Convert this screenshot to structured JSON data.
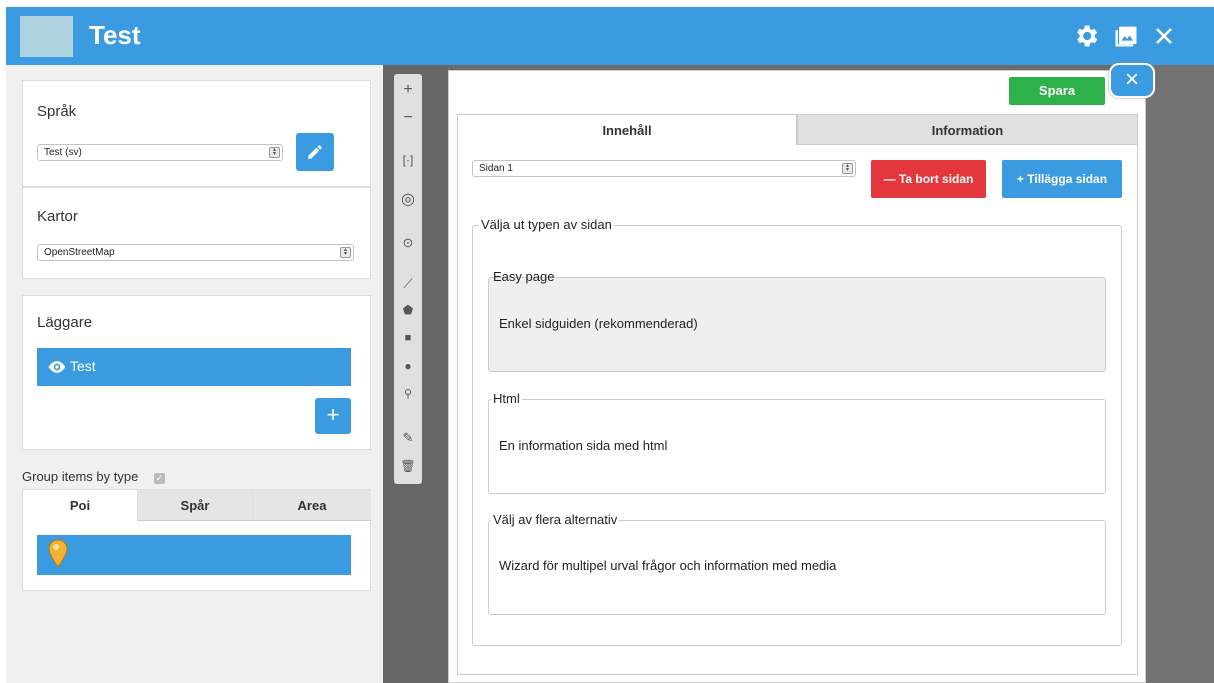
{
  "header": {
    "title": "Test"
  },
  "sidebar": {
    "language": {
      "label": "Språk",
      "value": "Test (sv)"
    },
    "maps": {
      "label": "Kartor",
      "value": "OpenStreetMap"
    },
    "layers": {
      "label": "Läggare",
      "items": [
        {
          "label": "Test"
        }
      ],
      "add_label": "+"
    },
    "group_label": "Group items by type",
    "type_tabs": [
      {
        "label": "Poi"
      },
      {
        "label": "Spår"
      },
      {
        "label": "Area"
      }
    ]
  },
  "modal": {
    "save_label": "Spara",
    "close_label": "×",
    "tabs": [
      {
        "label": "Innehåll"
      },
      {
        "label": "Information"
      }
    ],
    "page_select": "Sidan 1",
    "remove_label": "— Ta bort sidan",
    "add_label": "+ Tillägga sidan",
    "page_type": {
      "legend": "Välja ut typen av sidan",
      "options": [
        {
          "title": "Easy page",
          "desc": "Enkel sidguiden (rekommenderad)"
        },
        {
          "title": "Html",
          "desc": "En information sida med html"
        },
        {
          "title": "Välj av flera alternativ",
          "desc": "Wizard för multipel urval frågor och information med media"
        }
      ]
    }
  },
  "colors": {
    "accent": "#3a9be0",
    "save": "#2eb04a",
    "danger": "#e4373d"
  }
}
